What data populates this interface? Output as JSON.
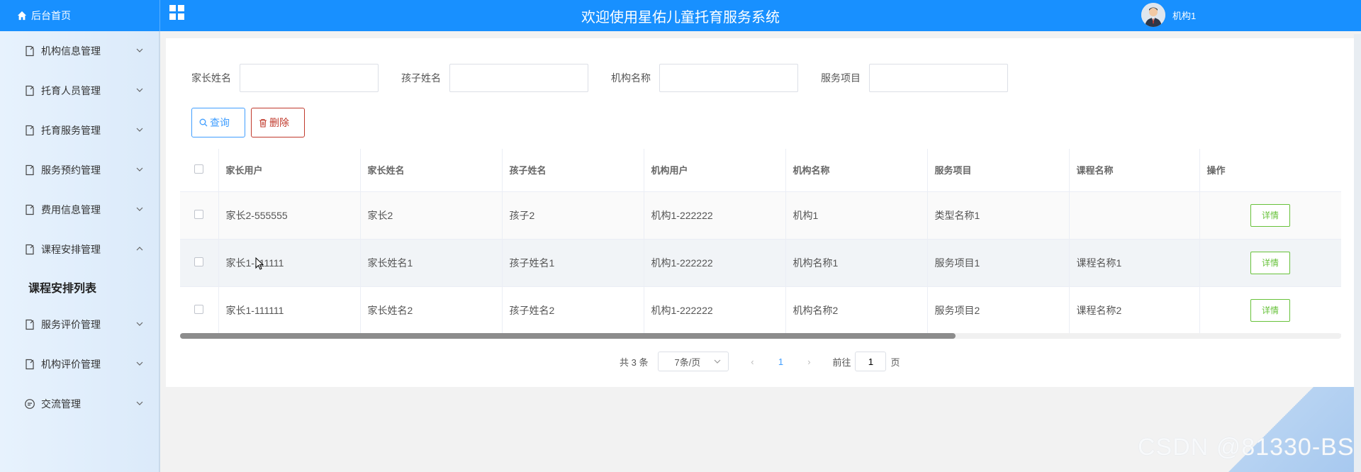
{
  "header": {
    "home_label": "后台首页",
    "title": "欢迎使用星佑儿童托育服务系统",
    "user_name": "机构1"
  },
  "sidebar": {
    "items": [
      {
        "label": "机构信息管理",
        "icon": "file-icon",
        "expanded": false
      },
      {
        "label": "托育人员管理",
        "icon": "file-icon",
        "expanded": false
      },
      {
        "label": "托育服务管理",
        "icon": "file-icon",
        "expanded": false
      },
      {
        "label": "服务预约管理",
        "icon": "file-icon",
        "expanded": false
      },
      {
        "label": "费用信息管理",
        "icon": "file-icon",
        "expanded": false
      },
      {
        "label": "课程安排管理",
        "icon": "file-icon",
        "expanded": true
      },
      {
        "label": "服务评价管理",
        "icon": "file-icon",
        "expanded": false
      },
      {
        "label": "机构评价管理",
        "icon": "file-icon",
        "expanded": false
      },
      {
        "label": "交流管理",
        "icon": "chat-icon",
        "expanded": false
      }
    ],
    "submenu_active": "课程安排列表"
  },
  "search": {
    "fields": [
      {
        "label": "家长姓名",
        "value": ""
      },
      {
        "label": "孩子姓名",
        "value": ""
      },
      {
        "label": "机构名称",
        "value": ""
      },
      {
        "label": "服务项目",
        "value": ""
      }
    ],
    "query_label": "查询",
    "delete_label": "删除"
  },
  "table": {
    "columns": [
      "家长用户",
      "家长姓名",
      "孩子姓名",
      "机构用户",
      "机构名称",
      "服务项目",
      "课程名称",
      "操作"
    ],
    "rows": [
      [
        "家长2-555555",
        "家长2",
        "孩子2",
        "机构1-222222",
        "机构1",
        "类型名称1",
        ""
      ],
      [
        "家长1-111111",
        "家长姓名1",
        "孩子姓名1",
        "机构1-222222",
        "机构名称1",
        "服务项目1",
        "课程名称1"
      ],
      [
        "家长1-111111",
        "家长姓名2",
        "孩子姓名2",
        "机构1-222222",
        "机构名称2",
        "服务项目2",
        "课程名称2"
      ]
    ],
    "detail_label": "详情"
  },
  "pagination": {
    "total_text": "共 3 条",
    "page_size": "7条/页",
    "current_page": "1",
    "goto_prefix": "前往",
    "goto_value": "1",
    "goto_suffix": "页"
  },
  "watermark": "CSDN @81330-BS",
  "colors": {
    "header": "#1890ff",
    "query_button": "#409eff",
    "delete_button": "#c0392b",
    "detail_button": "#67c23a"
  }
}
